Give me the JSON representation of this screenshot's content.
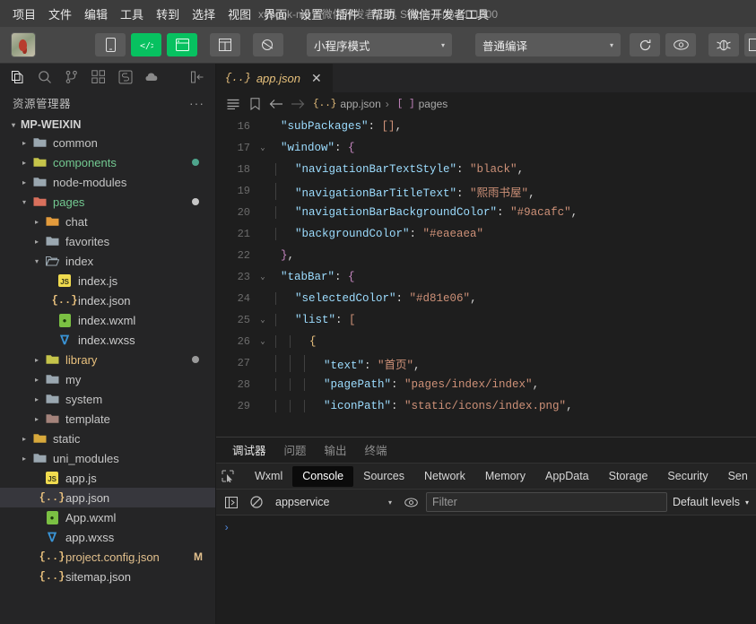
{
  "menubar": {
    "items": [
      "项目",
      "文件",
      "编辑",
      "工具",
      "转到",
      "选择",
      "视图",
      "界面",
      "设置",
      "插件",
      "帮助",
      "微信开发者工具"
    ],
    "window_title": "xybook-mp",
    "window_subtitle": "微信开发者工具 Stable 1.05.2111300",
    "separator": "-"
  },
  "toolbar": {
    "avatar_label": "user-avatar",
    "buttons": [
      {
        "name": "simulator-toggle-button",
        "icon": "phone-icon",
        "style": "plain"
      },
      {
        "name": "editor-toggle-button",
        "icon": "code-icon",
        "style": "green"
      },
      {
        "name": "debugger-toggle-button",
        "icon": "debug-panel-icon",
        "style": "green"
      },
      {
        "name": "layout-button",
        "icon": "layout-icon",
        "style": "plain"
      },
      {
        "name": "cloud-button",
        "icon": "cloud-icon",
        "style": "plain"
      }
    ],
    "mode_select": {
      "value": "小程序模式",
      "caret": "▾"
    },
    "compile_select": {
      "value": "普通编译",
      "caret": "▾"
    },
    "right_buttons": [
      {
        "name": "refresh-button",
        "icon": "refresh-icon"
      },
      {
        "name": "preview-button",
        "icon": "eye-icon"
      },
      {
        "name": "real-device-debug-button",
        "icon": "bug-icon"
      },
      {
        "name": "more-button",
        "icon": "more-icon"
      }
    ]
  },
  "activitybar": {
    "icons": [
      {
        "name": "explorer-icon",
        "active": true
      },
      {
        "name": "search-icon",
        "active": false
      },
      {
        "name": "source-control-icon",
        "active": false
      },
      {
        "name": "extensions-icon",
        "active": false
      },
      {
        "name": "snippets-icon",
        "active": false
      },
      {
        "name": "cloud-dev-icon",
        "active": false
      },
      {
        "name": "collapse-sidebar-icon",
        "active": false
      }
    ]
  },
  "explorer": {
    "title": "资源管理器",
    "more_label": "···",
    "root": {
      "label": "MP-WEIXIN",
      "twisty": "▾"
    },
    "tree": [
      {
        "label": "common",
        "type": "folder",
        "depth": 1,
        "twisty": "▸",
        "icon": "folder-icon",
        "color": "#c5c5c5",
        "dot": ""
      },
      {
        "label": "components",
        "type": "folder",
        "depth": 1,
        "twisty": "▸",
        "icon": "folder-yellow-icon",
        "color": "#73c991",
        "dot": "#4ea58c"
      },
      {
        "label": "node-modules",
        "type": "folder",
        "depth": 1,
        "twisty": "▸",
        "icon": "folder-icon",
        "color": "#c5c5c5",
        "dot": ""
      },
      {
        "label": "pages",
        "type": "folder",
        "depth": 1,
        "twisty": "▾",
        "icon": "folder-red-icon",
        "color": "#73c991",
        "dot": "#c5c5c5"
      },
      {
        "label": "chat",
        "type": "folder",
        "depth": 2,
        "twisty": "▸",
        "icon": "folder-orange-icon",
        "color": "#c5c5c5",
        "dot": ""
      },
      {
        "label": "favorites",
        "type": "folder",
        "depth": 2,
        "twisty": "▸",
        "icon": "folder-icon",
        "color": "#c5c5c5",
        "dot": ""
      },
      {
        "label": "index",
        "type": "folder",
        "depth": 2,
        "twisty": "▾",
        "icon": "folder-open-icon",
        "color": "#c5c5c5",
        "dot": ""
      },
      {
        "label": "index.js",
        "type": "file",
        "depth": 3,
        "twisty": "",
        "icon": "js-file-icon",
        "color": "#cccccc",
        "dot": ""
      },
      {
        "label": "index.json",
        "type": "file",
        "depth": 3,
        "twisty": "",
        "icon": "json-file-icon",
        "color": "#cccccc",
        "dot": ""
      },
      {
        "label": "index.wxml",
        "type": "file",
        "depth": 3,
        "twisty": "",
        "icon": "wxml-file-icon",
        "color": "#cccccc",
        "dot": ""
      },
      {
        "label": "index.wxss",
        "type": "file",
        "depth": 3,
        "twisty": "",
        "icon": "wxss-file-icon",
        "color": "#cccccc",
        "dot": ""
      },
      {
        "label": "library",
        "type": "folder",
        "depth": 2,
        "twisty": "▸",
        "icon": "folder-yellow-icon",
        "color": "#e8c07d",
        "dot": "#9a9a9a"
      },
      {
        "label": "my",
        "type": "folder",
        "depth": 2,
        "twisty": "▸",
        "icon": "folder-icon",
        "color": "#c5c5c5",
        "dot": ""
      },
      {
        "label": "system",
        "type": "folder",
        "depth": 2,
        "twisty": "▸",
        "icon": "folder-icon",
        "color": "#c5c5c5",
        "dot": ""
      },
      {
        "label": "template",
        "type": "folder",
        "depth": 2,
        "twisty": "▸",
        "icon": "folder-brown-icon",
        "color": "#c5c5c5",
        "dot": ""
      },
      {
        "label": "static",
        "type": "folder",
        "depth": 1,
        "twisty": "▸",
        "icon": "folder-amber-icon",
        "color": "#c5c5c5",
        "dot": ""
      },
      {
        "label": "uni_modules",
        "type": "folder",
        "depth": 1,
        "twisty": "▸",
        "icon": "folder-icon",
        "color": "#c5c5c5",
        "dot": ""
      },
      {
        "label": "app.js",
        "type": "file",
        "depth": 2,
        "twisty": "",
        "icon": "js-file-icon",
        "color": "#cccccc",
        "dot": ""
      },
      {
        "label": "app.json",
        "type": "file",
        "depth": 2,
        "twisty": "",
        "icon": "json-file-icon",
        "color": "#cccccc",
        "dot": "",
        "selected": true
      },
      {
        "label": "App.wxml",
        "type": "file",
        "depth": 2,
        "twisty": "",
        "icon": "wxml-file-icon",
        "color": "#cccccc",
        "dot": ""
      },
      {
        "label": "app.wxss",
        "type": "file",
        "depth": 2,
        "twisty": "",
        "icon": "wxss-file-icon",
        "color": "#cccccc",
        "dot": ""
      },
      {
        "label": "project.config.json",
        "type": "file",
        "depth": 2,
        "twisty": "",
        "icon": "json-file-icon",
        "color": "#e2c08d",
        "dot": "",
        "badge": "M"
      },
      {
        "label": "sitemap.json",
        "type": "file",
        "depth": 2,
        "twisty": "",
        "icon": "json-file-icon",
        "color": "#cccccc",
        "dot": ""
      }
    ]
  },
  "editor": {
    "tab": {
      "label": "app.json",
      "icon": "json-file-icon",
      "close": "✕"
    },
    "breadcrumb": {
      "icons": [
        "outline-icon",
        "bookmark-icon",
        "back-arrow-icon",
        "forward-arrow-icon"
      ],
      "file": "app.json",
      "separator": "›",
      "symbol": "pages",
      "symbol_prefix": "[ ]"
    },
    "lines": [
      {
        "n": "16",
        "fold": "",
        "indent": 1,
        "tokens": [
          {
            "t": "\"subPackages\"",
            "c": "key"
          },
          {
            "t": ": ",
            "c": "punc"
          },
          {
            "t": "[]",
            "c": "brk"
          },
          {
            "t": ",",
            "c": "punc"
          }
        ]
      },
      {
        "n": "17",
        "fold": "⌄",
        "indent": 1,
        "tokens": [
          {
            "t": "\"window\"",
            "c": "key"
          },
          {
            "t": ": ",
            "c": "punc"
          },
          {
            "t": "{",
            "c": "brace"
          }
        ]
      },
      {
        "n": "18",
        "fold": "",
        "indent": 2,
        "tokens": [
          {
            "t": "\"navigationBarTextStyle\"",
            "c": "key"
          },
          {
            "t": ": ",
            "c": "punc"
          },
          {
            "t": "\"black\"",
            "c": "str"
          },
          {
            "t": ",",
            "c": "punc"
          }
        ]
      },
      {
        "n": "19",
        "fold": "",
        "indent": 2,
        "tokens": [
          {
            "t": "\"navigationBarTitleText\"",
            "c": "key"
          },
          {
            "t": ": ",
            "c": "punc"
          },
          {
            "t": "\"熙雨书屋\"",
            "c": "str"
          },
          {
            "t": ",",
            "c": "punc"
          }
        ]
      },
      {
        "n": "20",
        "fold": "",
        "indent": 2,
        "tokens": [
          {
            "t": "\"navigationBarBackgroundColor\"",
            "c": "key"
          },
          {
            "t": ": ",
            "c": "punc"
          },
          {
            "t": "\"#9acafc\"",
            "c": "str"
          },
          {
            "t": ",",
            "c": "punc"
          }
        ]
      },
      {
        "n": "21",
        "fold": "",
        "indent": 2,
        "tokens": [
          {
            "t": "\"backgroundColor\"",
            "c": "key"
          },
          {
            "t": ": ",
            "c": "punc"
          },
          {
            "t": "\"#eaeaea\"",
            "c": "str"
          }
        ]
      },
      {
        "n": "22",
        "fold": "",
        "indent": 1,
        "tokens": [
          {
            "t": "}",
            "c": "brace"
          },
          {
            "t": ",",
            "c": "punc"
          }
        ]
      },
      {
        "n": "23",
        "fold": "⌄",
        "indent": 1,
        "tokens": [
          {
            "t": "\"tabBar\"",
            "c": "key"
          },
          {
            "t": ": ",
            "c": "punc"
          },
          {
            "t": "{",
            "c": "brace"
          }
        ]
      },
      {
        "n": "24",
        "fold": "",
        "indent": 2,
        "tokens": [
          {
            "t": "\"selectedColor\"",
            "c": "key"
          },
          {
            "t": ": ",
            "c": "punc"
          },
          {
            "t": "\"#d81e06\"",
            "c": "str"
          },
          {
            "t": ",",
            "c": "punc"
          }
        ]
      },
      {
        "n": "25",
        "fold": "⌄",
        "indent": 2,
        "tokens": [
          {
            "t": "\"list\"",
            "c": "key"
          },
          {
            "t": ": ",
            "c": "punc"
          },
          {
            "t": "[",
            "c": "brk"
          }
        ]
      },
      {
        "n": "26",
        "fold": "⌄",
        "indent": 3,
        "tokens": [
          {
            "t": "{",
            "c": "brace2"
          }
        ]
      },
      {
        "n": "27",
        "fold": "",
        "indent": 4,
        "tokens": [
          {
            "t": "\"text\"",
            "c": "key"
          },
          {
            "t": ": ",
            "c": "punc"
          },
          {
            "t": "\"首页\"",
            "c": "str"
          },
          {
            "t": ",",
            "c": "punc"
          }
        ]
      },
      {
        "n": "28",
        "fold": "",
        "indent": 4,
        "tokens": [
          {
            "t": "\"pagePath\"",
            "c": "key"
          },
          {
            "t": ": ",
            "c": "punc"
          },
          {
            "t": "\"pages/index/index\"",
            "c": "str"
          },
          {
            "t": ",",
            "c": "punc"
          }
        ]
      },
      {
        "n": "29",
        "fold": "",
        "indent": 4,
        "tokens": [
          {
            "t": "\"iconPath\"",
            "c": "key"
          },
          {
            "t": ": ",
            "c": "punc"
          },
          {
            "t": "\"static/icons/index.png\"",
            "c": "str"
          },
          {
            "t": ",",
            "c": "punc"
          }
        ]
      }
    ]
  },
  "panel": {
    "tabs": [
      {
        "label": "调试器",
        "active": true
      },
      {
        "label": "问题",
        "active": false
      },
      {
        "label": "输出",
        "active": false
      },
      {
        "label": "终端",
        "active": false
      }
    ],
    "devtools_tabs": [
      {
        "label": "Wxml",
        "active": false
      },
      {
        "label": "Console",
        "active": true
      },
      {
        "label": "Sources",
        "active": false
      },
      {
        "label": "Network",
        "active": false
      },
      {
        "label": "Memory",
        "active": false
      },
      {
        "label": "AppData",
        "active": false
      },
      {
        "label": "Storage",
        "active": false
      },
      {
        "label": "Security",
        "active": false
      },
      {
        "label": "Sen",
        "active": false
      }
    ],
    "console": {
      "context": "appservice",
      "context_caret": "▾",
      "filter_placeholder": "Filter",
      "filter_value": "",
      "levels": "Default levels",
      "levels_caret": "▾",
      "prompt": "›"
    }
  }
}
